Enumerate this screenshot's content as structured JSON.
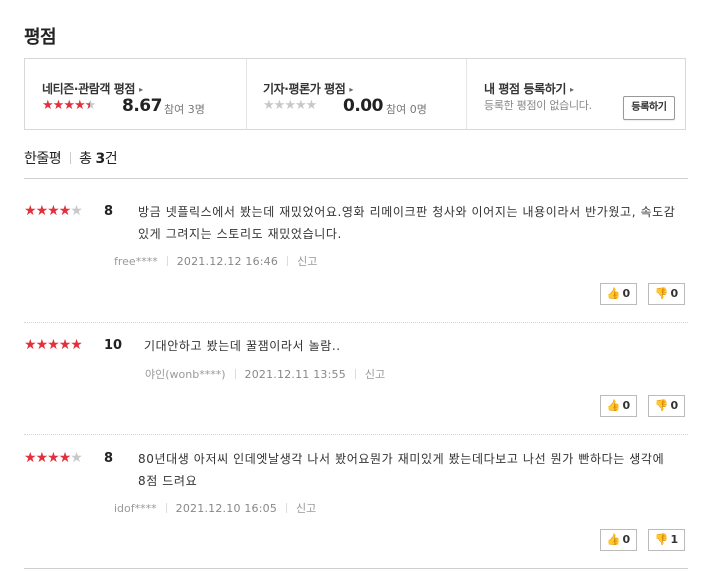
{
  "section_title": "평점",
  "summary": {
    "audience": {
      "title": "네티즌·관람객 평점",
      "score": "8.67",
      "participants": "참여 3명",
      "stars": [
        1,
        1,
        1,
        1,
        0.5
      ]
    },
    "critic": {
      "title": "기자·평론가 평점",
      "score": "0.00",
      "participants": "참여 0명",
      "stars": [
        0,
        0,
        0,
        0,
        0
      ]
    },
    "mine": {
      "title": "내 평점 등록하기",
      "note": "등록한 평점이 없습니다.",
      "button": "등록하기"
    },
    "arrow": "▸"
  },
  "list": {
    "label": "한줄평",
    "total_prefix": "총 ",
    "count": "3",
    "suffix": "건"
  },
  "icons": {
    "star": "★",
    "thumb_up": "👍",
    "thumb_down": "👎"
  },
  "colors": {
    "star_on": "#e2313c",
    "star_off": "#c8c8c8"
  },
  "reviews": [
    {
      "stars": [
        1,
        1,
        1,
        1,
        0
      ],
      "score": "8",
      "text": "방금 넷플릭스에서 봤는데 재밌었어요.영화 리메이크판 청사와 이어지는 내용이라서 반가웠고, 속도감 있게 그려지는 스토리도 재밌었습니다.",
      "author": "free****",
      "date": "2021.12.12 16:46",
      "report": "신고",
      "likes": "0",
      "dislikes": "0"
    },
    {
      "stars": [
        1,
        1,
        1,
        1,
        1
      ],
      "score": "10",
      "text": "기대안하고 봤는데 꿀잼이라서 놀람..",
      "author": "야인(wonb****)",
      "date": "2021.12.11 13:55",
      "report": "신고",
      "likes": "0",
      "dislikes": "0"
    },
    {
      "stars": [
        1,
        1,
        1,
        1,
        0
      ],
      "score": "8",
      "text": "80년대생 아저씨 인데엣날생각 나서 봤어요뭔가 재미있게 봤는데다보고 나선 뭔가 빤하다는 생각에 8점 드려요",
      "author": "idof****",
      "date": "2021.12.10 16:05",
      "report": "신고",
      "likes": "0",
      "dislikes": "1"
    }
  ]
}
